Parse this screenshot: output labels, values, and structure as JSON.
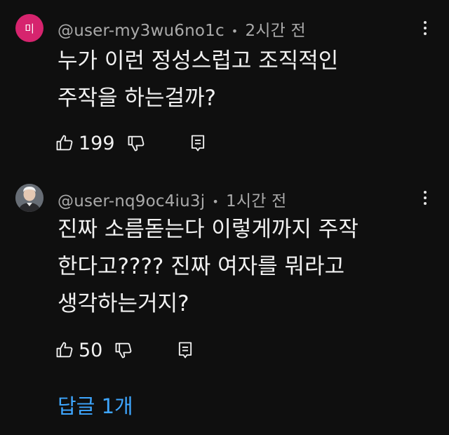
{
  "comments": [
    {
      "avatar_letter": "미",
      "avatar_color": "#d6246e",
      "author": "@user-my3wu6no1c",
      "time": "2시간 전",
      "lines": [
        "누가 이런 정성스럽고 조직적인",
        "주작을 하는걸까?"
      ],
      "likes": "199"
    },
    {
      "avatar_letter": "",
      "author": "@user-nq9oc4iu3j",
      "time": "1시간 전",
      "lines": [
        "진짜 소름돋는다 이렇게까지 주작",
        "한다고???? 진짜 여자를 뭐라고",
        "생각하는거지?"
      ],
      "likes": "50"
    }
  ],
  "replies_label": "답글 1개",
  "colors": {
    "background": "#0f0f0f",
    "text": "#f1f1f1",
    "meta": "#aaaaaa",
    "link": "#3ea6ff"
  },
  "icons": {
    "like": "thumb-up-icon",
    "dislike": "thumb-down-icon",
    "reply": "reply-comment-icon",
    "more": "more-vertical-icon"
  }
}
